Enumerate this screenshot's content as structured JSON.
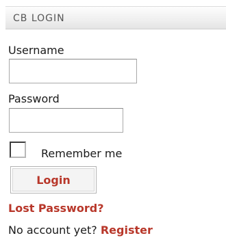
{
  "module": {
    "title": "CB LOGIN"
  },
  "form": {
    "username_label": "Username",
    "username_value": "",
    "password_label": "Password",
    "password_value": "",
    "remember_checked": false,
    "remember_label": "Remember me",
    "login_button_label": "Login"
  },
  "links": {
    "lost_password": "Lost Password?",
    "no_account_text": "No account yet?",
    "register": "Register"
  },
  "colors": {
    "accent": "#b8372a",
    "header_background": "#efefef",
    "header_text": "#555555",
    "text": "#1a1a1a"
  }
}
